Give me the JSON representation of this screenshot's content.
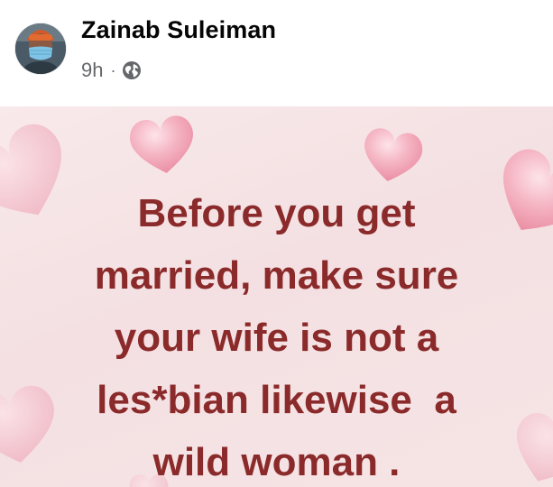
{
  "post": {
    "author": "Zainab Suleiman",
    "time": "9h",
    "separator": "·",
    "audience_icon": "globe-icon",
    "avatar_icon": "profile-avatar"
  },
  "image": {
    "lines": [
      "Before you get",
      "married, make sure",
      "your wife is not a",
      "les*bian likewise  a",
      "wild woman ."
    ]
  },
  "colors": {
    "text_primary": "#050505",
    "text_secondary": "#65676b",
    "quote_text": "#8b2a2a",
    "image_background": "#f6e4e5",
    "hearts": "#f2a7b8"
  }
}
